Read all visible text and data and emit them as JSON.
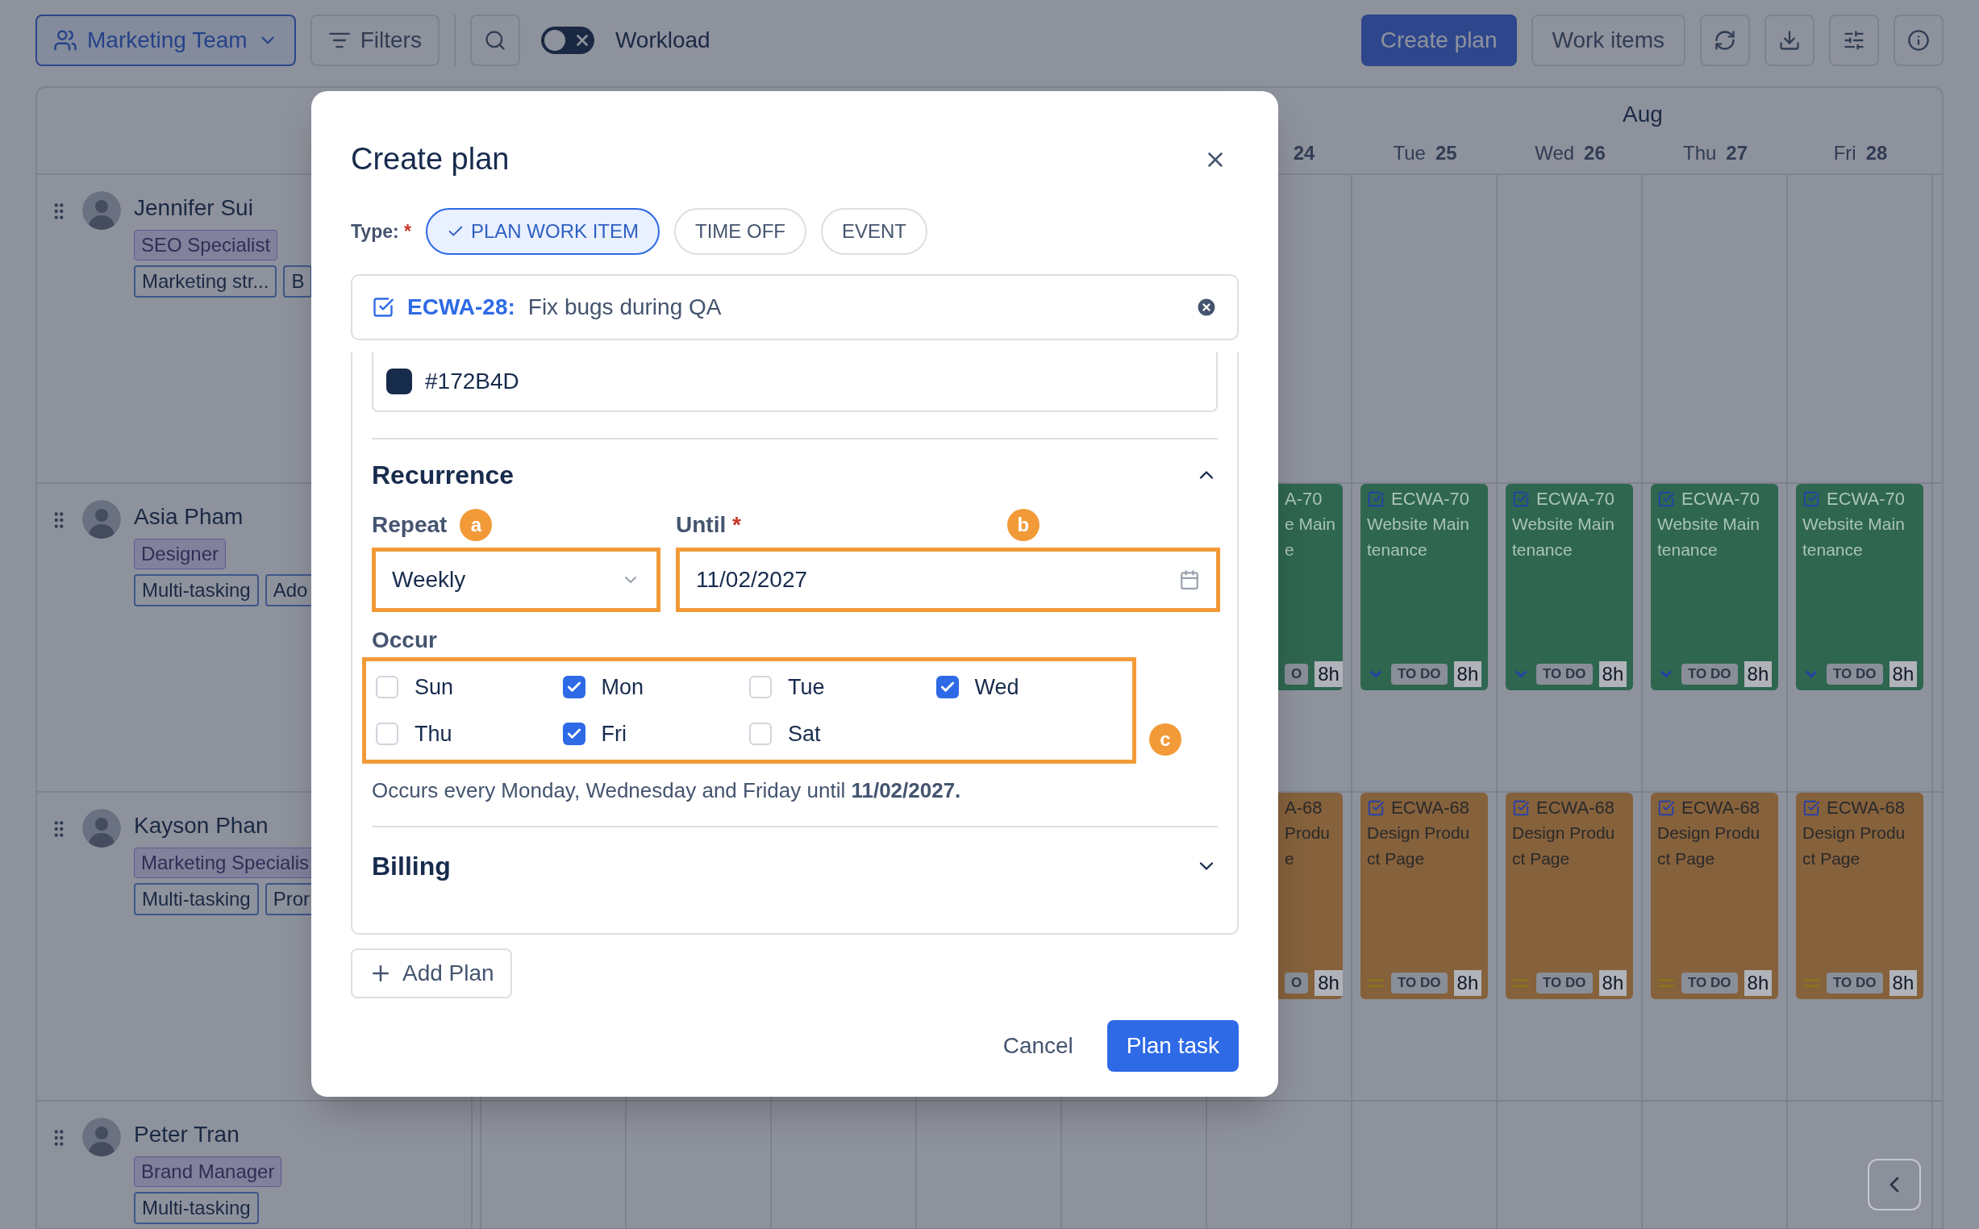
{
  "toolbar": {
    "team": "Marketing Team",
    "filters": "Filters",
    "workload_toggle": {
      "on": false
    },
    "workload": "Workload",
    "create_plan": "Create plan",
    "work_items": "Work items"
  },
  "calendar": {
    "month": "Aug",
    "days": [
      {
        "day": "24"
      },
      {
        "weekday": "Tue",
        "day": "25"
      },
      {
        "weekday": "Wed",
        "day": "26"
      },
      {
        "weekday": "Thu",
        "day": "27"
      },
      {
        "weekday": "Fri",
        "day": "28"
      }
    ]
  },
  "people": [
    {
      "name": "Jennifer Sui",
      "role": "SEO Specialist",
      "skills": [
        "Marketing str...",
        "B"
      ]
    },
    {
      "name": "Asia Pham",
      "role": "Designer",
      "skills": [
        "Multi-tasking",
        "Ado"
      ],
      "cards": [
        {
          "kind": "cut",
          "id": "A-70",
          "title": "e Main",
          "title_end": "e",
          "status": "O",
          "hours": "8h",
          "color": "#2f6650",
          "priority": {
            "kind": "low"
          }
        },
        {
          "kind": "full",
          "id": "ECWA-70",
          "title": "Website Maintenance",
          "status": "TO DO",
          "hours": "8h",
          "color": "#2f6650",
          "priority": {
            "kind": "low"
          }
        },
        {
          "kind": "full",
          "id": "ECWA-70",
          "title": "Website Maintenance",
          "status": "TO DO",
          "hours": "8h",
          "color": "#2f6650",
          "priority": {
            "kind": "low"
          }
        },
        {
          "kind": "full",
          "id": "ECWA-70",
          "title": "Website Maintenance",
          "status": "TO DO",
          "hours": "8h",
          "color": "#2f6650",
          "priority": {
            "kind": "low"
          }
        },
        {
          "kind": "full",
          "id": "ECWA-70",
          "title": "Website Maintenance",
          "status": "TO DO",
          "hours": "8h",
          "color": "#2f6650",
          "priority": {
            "kind": "low"
          }
        }
      ]
    },
    {
      "name": "Kayson Phan",
      "role": "Marketing Specialis",
      "skills": [
        "Multi-tasking",
        "Pror"
      ],
      "cards": [
        {
          "kind": "cut",
          "id": "A-68",
          "title": "Produ",
          "title_end": "e",
          "status": "O",
          "hours": "8h",
          "color": "#85613c",
          "priority": {
            "kind": "medium"
          }
        },
        {
          "kind": "full",
          "id": "ECWA-68",
          "title": "Design Product Page",
          "status": "TO DO",
          "hours": "8h",
          "color": "#85613c",
          "priority": {
            "kind": "medium"
          }
        },
        {
          "kind": "full",
          "id": "ECWA-68",
          "title": "Design Product Page",
          "status": "TO DO",
          "hours": "8h",
          "color": "#85613c",
          "priority": {
            "kind": "medium"
          }
        },
        {
          "kind": "full",
          "id": "ECWA-68",
          "title": "Design Product Page",
          "status": "TO DO",
          "hours": "8h",
          "color": "#85613c",
          "priority": {
            "kind": "medium"
          }
        },
        {
          "kind": "full",
          "id": "ECWA-68",
          "title": "Design Product Page",
          "status": "TO DO",
          "hours": "8h",
          "color": "#85613c",
          "priority": {
            "kind": "medium"
          }
        }
      ]
    },
    {
      "name": "Peter Tran",
      "role": "Brand Manager",
      "skills": [
        "Multi-tasking"
      ]
    }
  ],
  "dialog": {
    "title": "Create plan",
    "type_label": "Type:",
    "required_mark": "*",
    "types": [
      {
        "label": "PLAN WORK ITEM",
        "selected": true
      },
      {
        "label": "TIME OFF",
        "selected": false
      },
      {
        "label": "EVENT",
        "selected": false
      }
    ],
    "work_item": {
      "key": "ECWA-28:",
      "summary": "Fix bugs during QA"
    },
    "color_value": "#172B4D",
    "recurrence": {
      "title": "Recurrence",
      "expanded": true,
      "repeat_label": "Repeat",
      "repeat_badge": "a",
      "repeat": "Weekly",
      "until_label": "Until",
      "until_mark": "*",
      "until_badge": "b",
      "until": "11/02/2027",
      "occur_label": "Occur",
      "occur_badge": "c",
      "days": [
        {
          "label": "Sun",
          "checked": false
        },
        {
          "label": "Mon",
          "checked": true
        },
        {
          "label": "Tue",
          "checked": false
        },
        {
          "label": "Wed",
          "checked": true
        },
        {
          "label": "Thu",
          "checked": false
        },
        {
          "label": "Fri",
          "checked": true
        },
        {
          "label": "Sat",
          "checked": false
        }
      ],
      "summary": "Occurs every Monday, Wednesday and Friday until **11/02/2027.**"
    },
    "billing": {
      "title": "Billing",
      "expanded": false
    },
    "add_plan": "Add Plan",
    "cancel": "Cancel",
    "submit": "Plan task"
  }
}
